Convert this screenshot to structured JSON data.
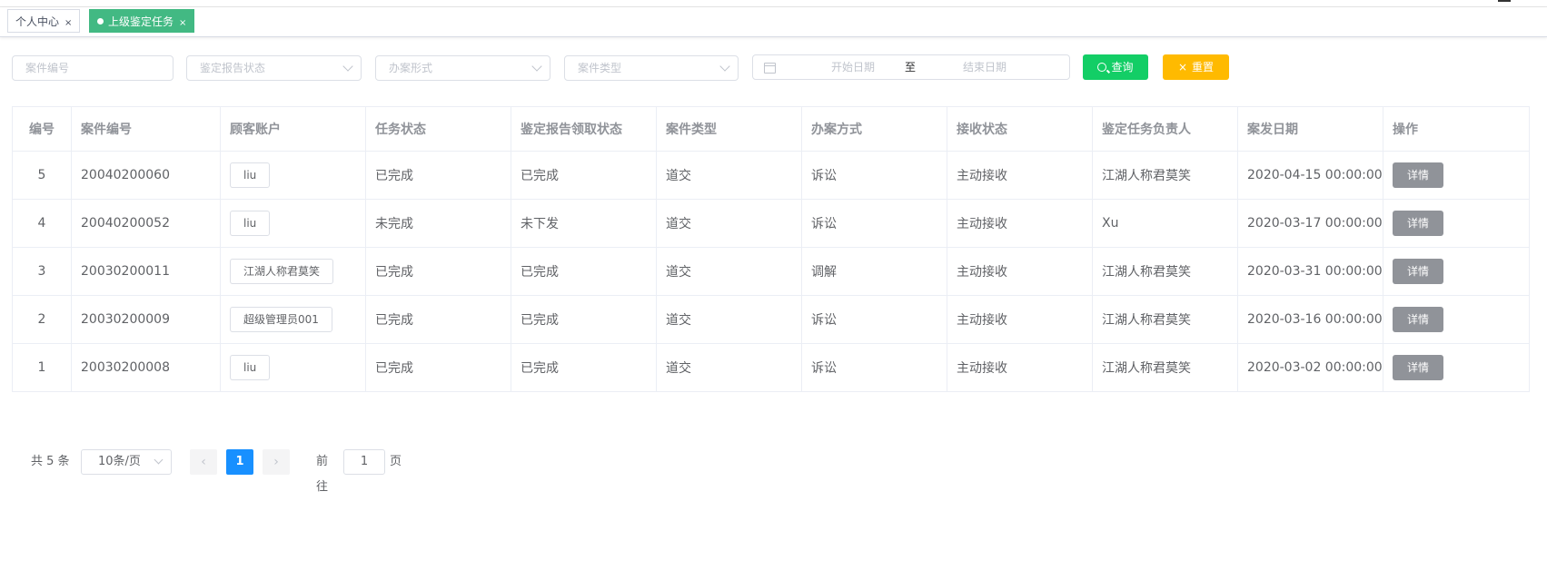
{
  "tabs": [
    {
      "label": "个人中心",
      "close": "×"
    },
    {
      "label": "上级鉴定任务",
      "close": "×"
    }
  ],
  "filters": {
    "case_no_placeholder": "案件编号",
    "report_status_placeholder": "鉴定报告状态",
    "handling_form_placeholder": "办案形式",
    "case_type_placeholder": "案件类型",
    "start_date_placeholder": "开始日期",
    "date_separator": "至",
    "end_date_placeholder": "结束日期",
    "search_label": "查询",
    "reset_label": "重置",
    "reset_icon": "×"
  },
  "table": {
    "headers": [
      "编号",
      "案件编号",
      "顾客账户",
      "任务状态",
      "鉴定报告领取状态",
      "案件类型",
      "办案方式",
      "接收状态",
      "鉴定任务负责人",
      "案发日期",
      "操作"
    ],
    "rows": [
      [
        "5",
        "20040200060",
        "liu",
        "已完成",
        "已完成",
        "道交",
        "诉讼",
        "主动接收",
        "江湖人称君莫笑",
        "2020-04-15 00:00:00",
        "详情"
      ],
      [
        "4",
        "20040200052",
        "liu",
        "未完成",
        "未下发",
        "道交",
        "诉讼",
        "主动接收",
        "Xu",
        "2020-03-17 00:00:00",
        "详情"
      ],
      [
        "3",
        "20030200011",
        "江湖人称君莫笑",
        "已完成",
        "已完成",
        "道交",
        "调解",
        "主动接收",
        "江湖人称君莫笑",
        "2020-03-31 00:00:00",
        "详情"
      ],
      [
        "2",
        "20030200009",
        "超级管理员001",
        "已完成",
        "已完成",
        "道交",
        "诉讼",
        "主动接收",
        "江湖人称君莫笑",
        "2020-03-16 00:00:00",
        "详情"
      ],
      [
        "1",
        "20030200008",
        "liu",
        "已完成",
        "已完成",
        "道交",
        "诉讼",
        "主动接收",
        "江湖人称君莫笑",
        "2020-03-02 00:00:00",
        "详情"
      ]
    ]
  },
  "pagination": {
    "total": "共 5 条",
    "page_size": "10条/页",
    "prev": "‹",
    "current_page": "1",
    "next": "›",
    "goto_label": "前往",
    "goto_value": "1",
    "page_suffix": "页",
    "active_color": "#1890ff"
  },
  "colors": {
    "tab_active": "#42b983",
    "search_button": "#13ce66",
    "reset_button": "#ffba00",
    "detail_button": "#909399"
  },
  "icons": [
    "close-icon",
    "dot-icon",
    "chevron-down-icon",
    "calendar-icon",
    "search-icon",
    "chevron-left-icon",
    "chevron-right-icon"
  ]
}
